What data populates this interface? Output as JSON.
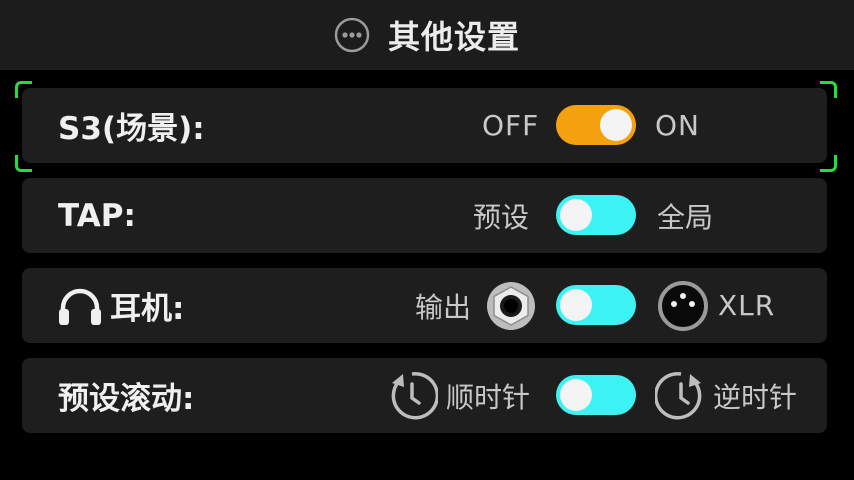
{
  "header": {
    "title": "其他设置",
    "icon": "more-options-icon"
  },
  "settings": [
    {
      "label": "S3(场景):",
      "left_option": "OFF",
      "right_option": "ON",
      "state": "on",
      "toggle_color": "#f5a00f"
    },
    {
      "label": "TAP:",
      "left_option": "预设",
      "right_option": "全局",
      "state": "off",
      "toggle_color": "#3df2f2"
    },
    {
      "label": "耳机:",
      "left_option": "输出",
      "right_option": "XLR",
      "state": "off",
      "toggle_color": "#3df2f2",
      "label_icon": "headphones-icon",
      "left_icon": "jack-output-icon",
      "right_icon": "xlr-connector-icon"
    },
    {
      "label": "预设滚动:",
      "left_option": "顺时针",
      "right_option": "逆时针",
      "state": "off",
      "toggle_color": "#3df2f2",
      "left_icon": "clockwise-icon",
      "right_icon": "counterclockwise-icon"
    }
  ],
  "focus_color": "#22e03a"
}
